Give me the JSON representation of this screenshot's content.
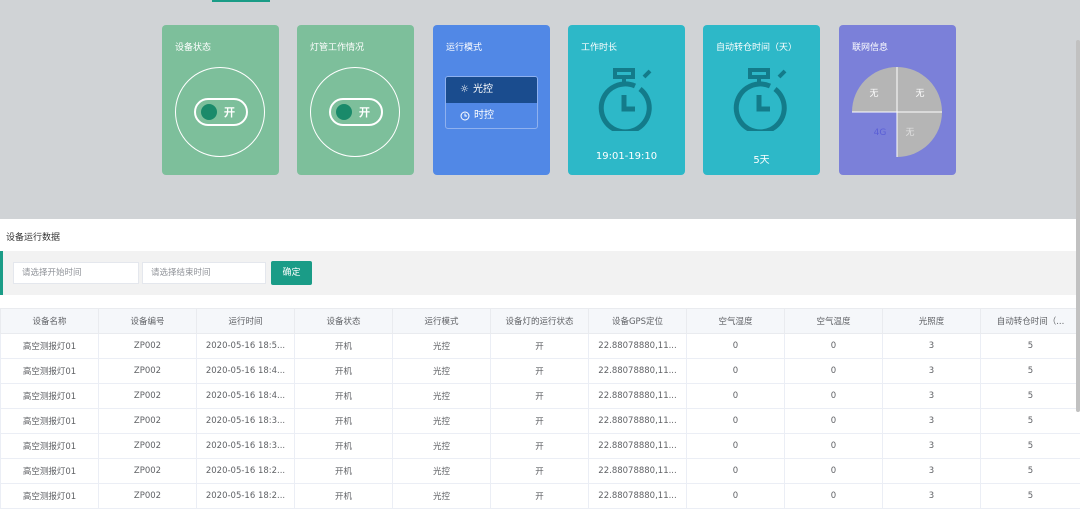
{
  "cards": {
    "device_status": {
      "title": "设备状态",
      "switch_text": "开"
    },
    "lamp_status": {
      "title": "灯管工作情况",
      "switch_text": "开"
    },
    "run_mode": {
      "title": "运行模式",
      "options": [
        "光控",
        "时控"
      ],
      "selected": "光控"
    },
    "work_time": {
      "title": "工作时长",
      "value": "19:01-19:10"
    },
    "auto_return": {
      "title": "自动转仓时间（天）",
      "value": "5天"
    },
    "network": {
      "title": "联网信息",
      "quadrants": [
        "无",
        "无",
        "4G",
        "无"
      ]
    }
  },
  "section": {
    "title": "设备运行数据"
  },
  "filter": {
    "start_placeholder": "请选择开始时间",
    "end_placeholder": "请选择结束时间",
    "confirm_label": "确定"
  },
  "table": {
    "columns": [
      "设备名称",
      "设备编号",
      "运行时间",
      "设备状态",
      "运行模式",
      "设备灯的运行状态",
      "设备GPS定位",
      "空气湿度",
      "空气温度",
      "光照度",
      "自动转仓时间（..."
    ],
    "rows": [
      [
        "高空测报灯01",
        "ZP002",
        "2020-05-16 18:5...",
        "开机",
        "光控",
        "开",
        "22.88078880,11...",
        "0",
        "0",
        "3",
        "5"
      ],
      [
        "高空测报灯01",
        "ZP002",
        "2020-05-16 18:4...",
        "开机",
        "光控",
        "开",
        "22.88078880,11...",
        "0",
        "0",
        "3",
        "5"
      ],
      [
        "高空测报灯01",
        "ZP002",
        "2020-05-16 18:4...",
        "开机",
        "光控",
        "开",
        "22.88078880,11...",
        "0",
        "0",
        "3",
        "5"
      ],
      [
        "高空测报灯01",
        "ZP002",
        "2020-05-16 18:3...",
        "开机",
        "光控",
        "开",
        "22.88078880,11...",
        "0",
        "0",
        "3",
        "5"
      ],
      [
        "高空测报灯01",
        "ZP002",
        "2020-05-16 18:3...",
        "开机",
        "光控",
        "开",
        "22.88078880,11...",
        "0",
        "0",
        "3",
        "5"
      ],
      [
        "高空测报灯01",
        "ZP002",
        "2020-05-16 18:2...",
        "开机",
        "光控",
        "开",
        "22.88078880,11...",
        "0",
        "0",
        "3",
        "5"
      ],
      [
        "高空测报灯01",
        "ZP002",
        "2020-05-16 18:2...",
        "开机",
        "光控",
        "开",
        "22.88078880,11...",
        "0",
        "0",
        "3",
        "5"
      ]
    ]
  },
  "colors": {
    "accent": "#1a9c87",
    "green_card": "#7dbf9b",
    "blue_card": "#5188e6",
    "teal_card": "#2db8c8",
    "purple_card": "#7b80d9"
  }
}
